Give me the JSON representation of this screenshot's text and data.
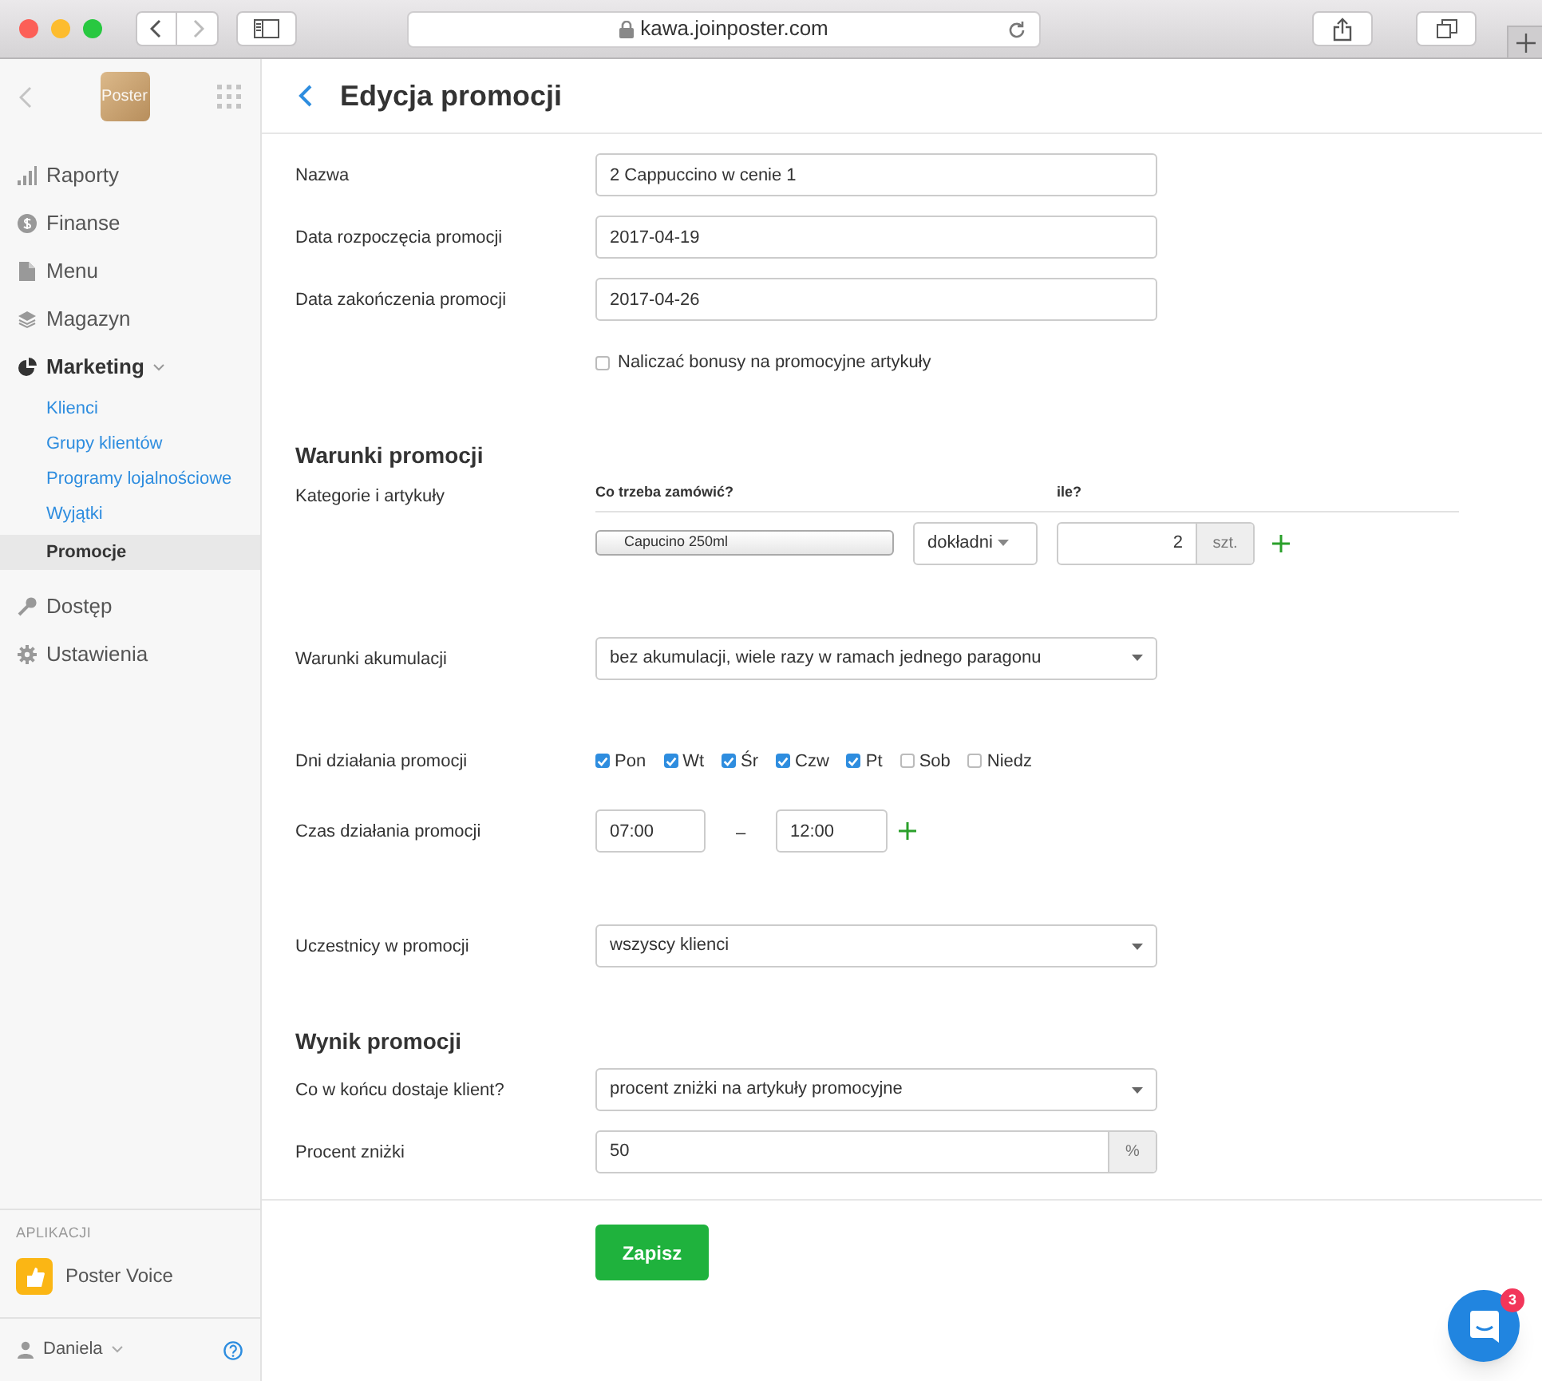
{
  "browser": {
    "url": "kawa.joinposter.com"
  },
  "sidebar": {
    "logo": "Poster",
    "items": [
      {
        "label": "Raporty",
        "expanded": false
      },
      {
        "label": "Finanse",
        "expanded": false
      },
      {
        "label": "Menu",
        "expanded": false
      },
      {
        "label": "Magazyn",
        "expanded": false
      },
      {
        "label": "Marketing",
        "expanded": true,
        "children": [
          {
            "label": "Klienci",
            "selected": false
          },
          {
            "label": "Grupy klientów",
            "selected": false
          },
          {
            "label": "Programy lojalnościowe",
            "selected": false
          },
          {
            "label": "Wyjątki",
            "selected": false
          },
          {
            "label": "Promocje",
            "selected": true
          }
        ]
      },
      {
        "label": "Dostęp",
        "expanded": false
      },
      {
        "label": "Ustawienia",
        "expanded": false
      }
    ],
    "apps_heading": "APLIKACJI",
    "apps": [
      {
        "label": "Poster Voice"
      }
    ],
    "user": "Daniela"
  },
  "page_title": "Edycja promocji",
  "fields": [
    {
      "label": "Nazwa",
      "value": "2 Cappuccino w cenie 1"
    },
    {
      "label": "Data rozpoczęcia promocji",
      "value": "2017-04-19"
    },
    {
      "label": "Data zakończenia promocji",
      "value": "2017-04-26"
    }
  ],
  "bonus_checkbox": {
    "label": "Naliczać bonusy na promocyjne artykuły",
    "checked": false
  },
  "conditions": {
    "heading": "Warunki promocji",
    "label": "Kategorie i artykuły",
    "column_headers": [
      "Co trzeba zamówić?",
      "ile?"
    ],
    "rows": [
      {
        "product": "Capucino 250ml",
        "mode": "dokładni",
        "quantity": "2",
        "unit": "szt."
      }
    ],
    "accumulation": {
      "label": "Warunki akumulacji",
      "value": "bez akumulacji, wiele razy w ramach jednego paragonu"
    },
    "days": {
      "label": "Dni działania promocji",
      "items": [
        {
          "label": "Pon",
          "checked": true
        },
        {
          "label": "Wt",
          "checked": true
        },
        {
          "label": "Śr",
          "checked": true
        },
        {
          "label": "Czw",
          "checked": true
        },
        {
          "label": "Pt",
          "checked": true
        },
        {
          "label": "Sob",
          "checked": false
        },
        {
          "label": "Niedz",
          "checked": false
        }
      ]
    },
    "time": {
      "label": "Czas działania promocji",
      "from": "07:00",
      "separator": "–",
      "to": "12:00"
    },
    "participants": {
      "label": "Uczestnicy w promocji",
      "value": "wszyscy klienci"
    }
  },
  "result": {
    "heading": "Wynik promocji",
    "reward": {
      "label": "Co w końcu dostaje klient?",
      "value": "procent zniżki na artykuły promocyjne"
    },
    "discount": {
      "label": "Procent zniżki",
      "value": "50",
      "unit": "%"
    }
  },
  "save_button": "Zapisz",
  "chat": {
    "badge": "3"
  }
}
